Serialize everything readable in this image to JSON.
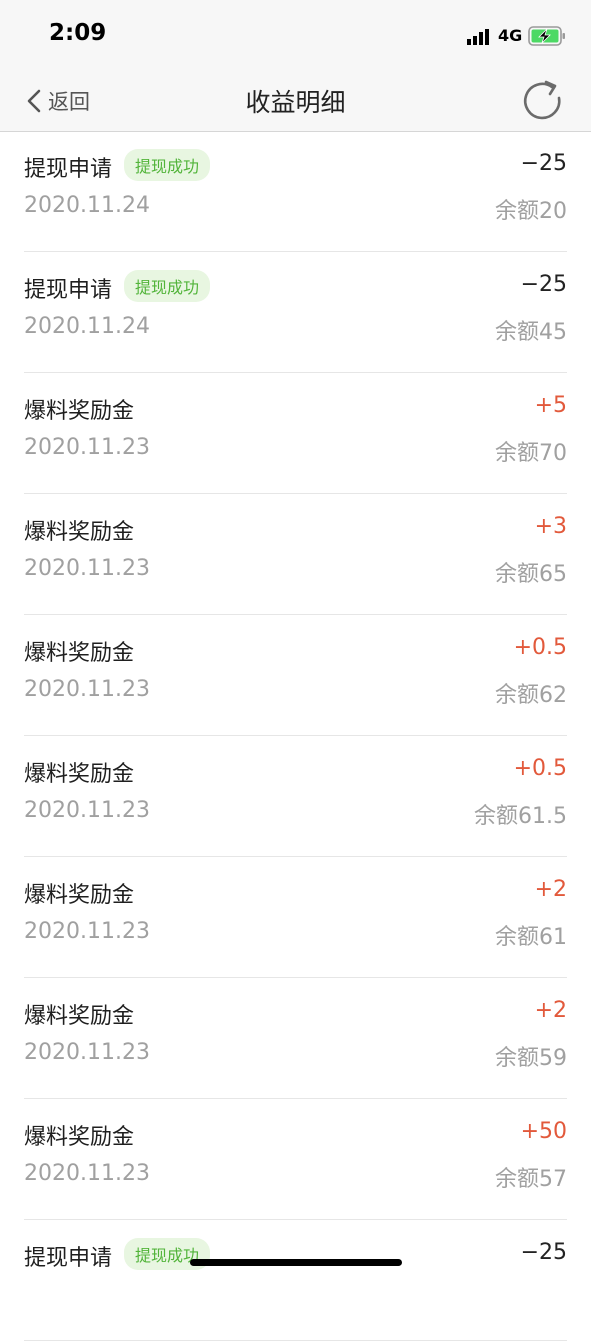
{
  "status": {
    "time": "2:09",
    "network": "4G"
  },
  "nav": {
    "back_label": "返回",
    "title": "收益明细"
  },
  "colors": {
    "positive": "#e2593b",
    "negative": "#222222",
    "badge_text": "#52b43a",
    "badge_bg": "#e8f6e1"
  },
  "records": [
    {
      "title": "提现申请",
      "badge": "提现成功",
      "amount": "−25",
      "sign": "negative",
      "date": "2020.11.24",
      "balance": "余额20"
    },
    {
      "title": "提现申请",
      "badge": "提现成功",
      "amount": "−25",
      "sign": "negative",
      "date": "2020.11.24",
      "balance": "余额45"
    },
    {
      "title": "爆料奖励金",
      "badge": "",
      "amount": "+5",
      "sign": "positive",
      "date": "2020.11.23",
      "balance": "余额70"
    },
    {
      "title": "爆料奖励金",
      "badge": "",
      "amount": "+3",
      "sign": "positive",
      "date": "2020.11.23",
      "balance": "余额65"
    },
    {
      "title": "爆料奖励金",
      "badge": "",
      "amount": "+0.5",
      "sign": "positive",
      "date": "2020.11.23",
      "balance": "余额62"
    },
    {
      "title": "爆料奖励金",
      "badge": "",
      "amount": "+0.5",
      "sign": "positive",
      "date": "2020.11.23",
      "balance": "余额61.5"
    },
    {
      "title": "爆料奖励金",
      "badge": "",
      "amount": "+2",
      "sign": "positive",
      "date": "2020.11.23",
      "balance": "余额61"
    },
    {
      "title": "爆料奖励金",
      "badge": "",
      "amount": "+2",
      "sign": "positive",
      "date": "2020.11.23",
      "balance": "余额59"
    },
    {
      "title": "爆料奖励金",
      "badge": "",
      "amount": "+50",
      "sign": "positive",
      "date": "2020.11.23",
      "balance": "余额57"
    },
    {
      "title": "提现申请",
      "badge": "提现成功",
      "amount": "−25",
      "sign": "negative",
      "date": "",
      "balance": ""
    }
  ]
}
